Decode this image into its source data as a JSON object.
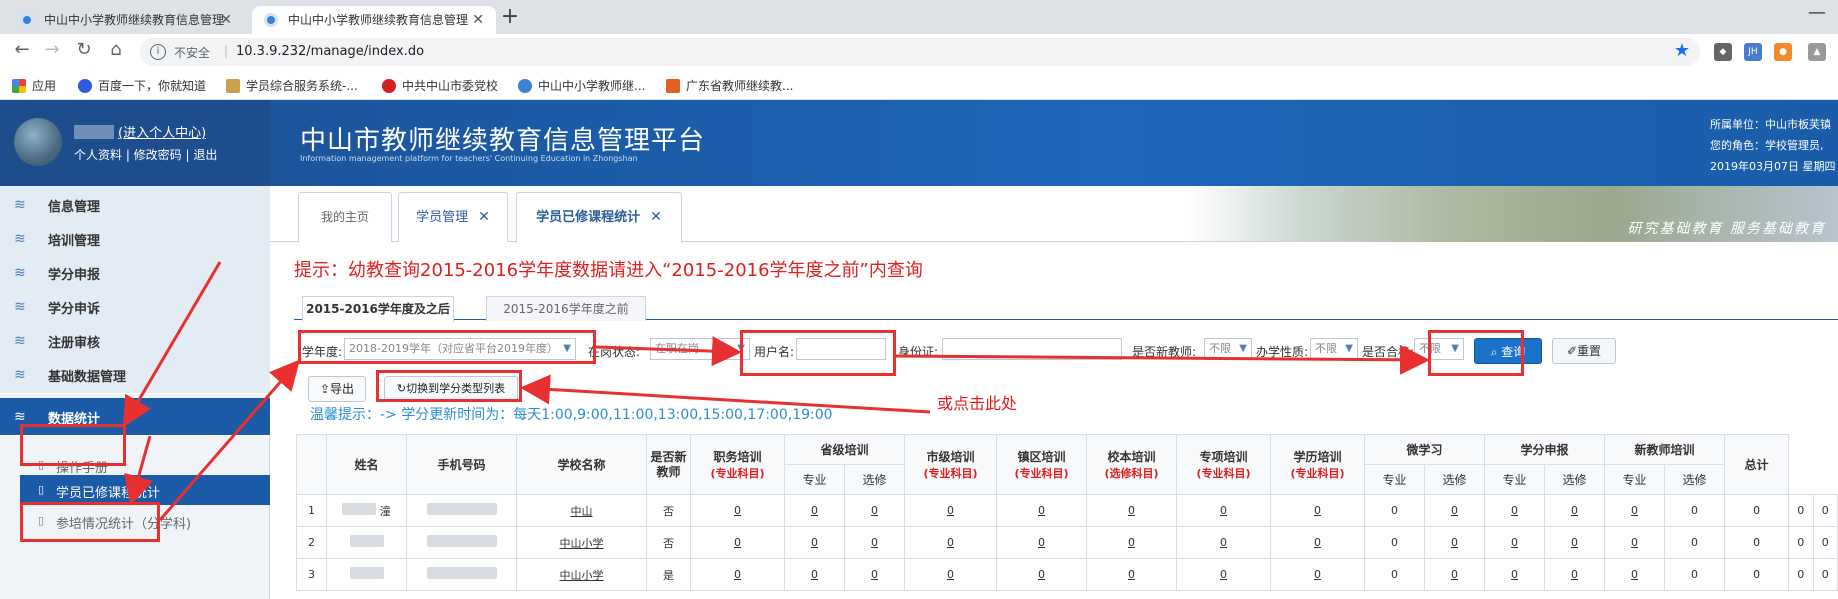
{
  "browser": {
    "tabs": [
      {
        "title": "中山中小学教师继续教育信息管理",
        "active": false
      },
      {
        "title": "中山中小学教师继续教育信息管理",
        "active": true
      }
    ],
    "address": {
      "security": "不安全",
      "url": "10.3.9.232/manage/index.do"
    },
    "extensions": [
      "JH"
    ],
    "bookmarks": [
      "应用",
      "百度一下，你就知道",
      "学员综合服务系统-...",
      "中共中山市委党校",
      "中山中小学教师继...",
      "广东省教师继续教..."
    ]
  },
  "header": {
    "user_link": "(进入个人中心)",
    "user_menu": "个人资料 | 修改密码 | 退出",
    "brand": "中山市教师继续教育信息管理平台",
    "brand_en": "Information management platform for teachers' Continuing Education in Zhongshan",
    "unit": "所属单位：中山市板芙镇",
    "role": "您的角色：学校管理员,",
    "date": "2019年03月07日 星期四"
  },
  "sidebar": {
    "items": [
      {
        "label": "信息管理"
      },
      {
        "label": "培训管理"
      },
      {
        "label": "学分申报"
      },
      {
        "label": "学分申诉"
      },
      {
        "label": "注册审核"
      },
      {
        "label": "基础数据管理"
      },
      {
        "label": "数据统计"
      }
    ],
    "subitems": [
      {
        "label": "操作手册"
      },
      {
        "label": "学员已修课程统计"
      },
      {
        "label": "参培情况统计（分学科)"
      }
    ]
  },
  "main": {
    "tabs": [
      "我的主页",
      "学员管理",
      "学员已修课程统计"
    ],
    "banner_motto": "研究基础教育  服务基础教育",
    "notice": "提示：幼教查询2015-2016学年度数据请进入“2015-2016学年度之前”内查询",
    "year_tabs": [
      "2015-2016学年度及之后",
      "2015-2016学年度之前"
    ],
    "filters": {
      "year_label": "学年度:",
      "year_value": "2018-2019学年（对应省平台2019年度）",
      "status_label": "在岗状态:",
      "status_value": "在职在岗",
      "username_label": "用户名:",
      "id_label": "身份证:",
      "newteacher_label": "是否新教师:",
      "newteacher_value": "不限",
      "nature_label": "办学性质:",
      "nature_value": "不限",
      "pass_label": "是否合格:",
      "pass_value": "不限",
      "query_btn": "查询",
      "reset_btn": "重置"
    },
    "export_btn": "导出",
    "switch_btn": "切换到学分类型列表",
    "tip": "温馨提示：-> 学分更新时间为：每天1:00,9:00,11:00,13:00,15:00,17:00,19:00",
    "annotation": "或点击此处"
  },
  "table": {
    "headers": {
      "name": "姓名",
      "phone": "手机号码",
      "school": "学校名称",
      "new": "是否新教师",
      "zhiwu": "职务培训",
      "sheng": "省级培训",
      "shi": "市级培训",
      "zhen": "镇区培训",
      "xiao": "校本培训",
      "zhuan": "专项培训",
      "xueli": "学历培训",
      "wei": "微学习",
      "xfsb": "学分申报",
      "xjs": "新教师培训",
      "total": "总计",
      "zy_tag": "(专业科目)",
      "xx_tag": "(选修科目)",
      "zy": "专业",
      "xx": "选修"
    },
    "rows": [
      {
        "idx": "1",
        "name": "潼",
        "school": "中山",
        "new": "否",
        "vals": [
          "0",
          "0",
          "0",
          "0",
          "0",
          "0",
          "0",
          "0",
          "0",
          "0",
          "0",
          "0",
          "0",
          "0",
          "0",
          "0",
          "0"
        ]
      },
      {
        "idx": "2",
        "name": "",
        "school": "中山小学",
        "new": "否",
        "vals": [
          "0",
          "0",
          "0",
          "0",
          "0",
          "0",
          "0",
          "0",
          "0",
          "0",
          "0",
          "0",
          "0",
          "0",
          "0",
          "0",
          "0"
        ]
      },
      {
        "idx": "3",
        "name": "",
        "school": "中山小学",
        "new": "是",
        "vals": [
          "0",
          "0",
          "0",
          "0",
          "0",
          "0",
          "0",
          "0",
          "0",
          "0",
          "0",
          "0",
          "0",
          "0",
          "0",
          "0",
          "0"
        ]
      }
    ]
  }
}
